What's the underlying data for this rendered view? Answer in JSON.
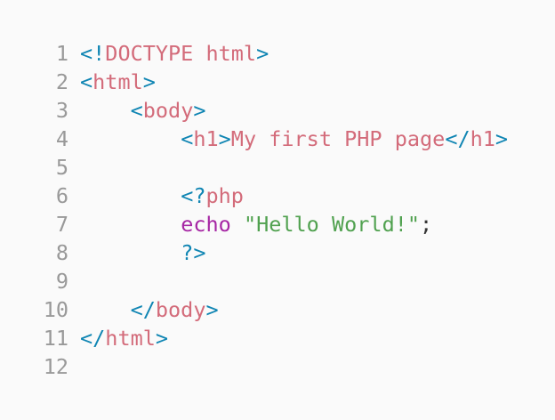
{
  "editor": {
    "colors": {
      "background": "#fafafa",
      "line_number": "#999999",
      "punctuation": "#0f85b3",
      "tag": "#d36b7a",
      "keyword": "#a626a4",
      "string": "#50a14f",
      "plain": "#333333"
    },
    "lines": [
      {
        "number": "1",
        "tokens": [
          {
            "t": "<!",
            "c": "punct"
          },
          {
            "t": "DOCTYPE html",
            "c": "tag"
          },
          {
            "t": ">",
            "c": "punct"
          }
        ]
      },
      {
        "number": "2",
        "tokens": [
          {
            "t": "<",
            "c": "punct"
          },
          {
            "t": "html",
            "c": "tag"
          },
          {
            "t": ">",
            "c": "punct"
          }
        ]
      },
      {
        "number": "3",
        "tokens": [
          {
            "t": "    ",
            "c": "plain"
          },
          {
            "t": "<",
            "c": "punct"
          },
          {
            "t": "body",
            "c": "tag"
          },
          {
            "t": ">",
            "c": "punct"
          }
        ]
      },
      {
        "number": "4",
        "tokens": [
          {
            "t": "        ",
            "c": "plain"
          },
          {
            "t": "<",
            "c": "punct"
          },
          {
            "t": "h1",
            "c": "tag"
          },
          {
            "t": ">",
            "c": "punct"
          },
          {
            "t": "My first PHP page",
            "c": "text"
          },
          {
            "t": "</",
            "c": "punct"
          },
          {
            "t": "h1",
            "c": "tag"
          },
          {
            "t": ">",
            "c": "punct"
          }
        ]
      },
      {
        "number": "5",
        "tokens": []
      },
      {
        "number": "6",
        "tokens": [
          {
            "t": "        ",
            "c": "plain"
          },
          {
            "t": "<?",
            "c": "punct"
          },
          {
            "t": "php",
            "c": "tag"
          }
        ]
      },
      {
        "number": "7",
        "tokens": [
          {
            "t": "        ",
            "c": "plain"
          },
          {
            "t": "echo",
            "c": "kw"
          },
          {
            "t": " ",
            "c": "plain"
          },
          {
            "t": "\"Hello World!\"",
            "c": "str"
          },
          {
            "t": ";",
            "c": "semi"
          }
        ]
      },
      {
        "number": "8",
        "tokens": [
          {
            "t": "        ",
            "c": "plain"
          },
          {
            "t": "?>",
            "c": "punct"
          }
        ]
      },
      {
        "number": "9",
        "tokens": []
      },
      {
        "number": "10",
        "tokens": [
          {
            "t": "    ",
            "c": "plain"
          },
          {
            "t": "</",
            "c": "punct"
          },
          {
            "t": "body",
            "c": "tag"
          },
          {
            "t": ">",
            "c": "punct"
          }
        ]
      },
      {
        "number": "11",
        "tokens": [
          {
            "t": "</",
            "c": "punct"
          },
          {
            "t": "html",
            "c": "tag"
          },
          {
            "t": ">",
            "c": "punct"
          }
        ]
      },
      {
        "number": "12",
        "tokens": []
      }
    ]
  }
}
